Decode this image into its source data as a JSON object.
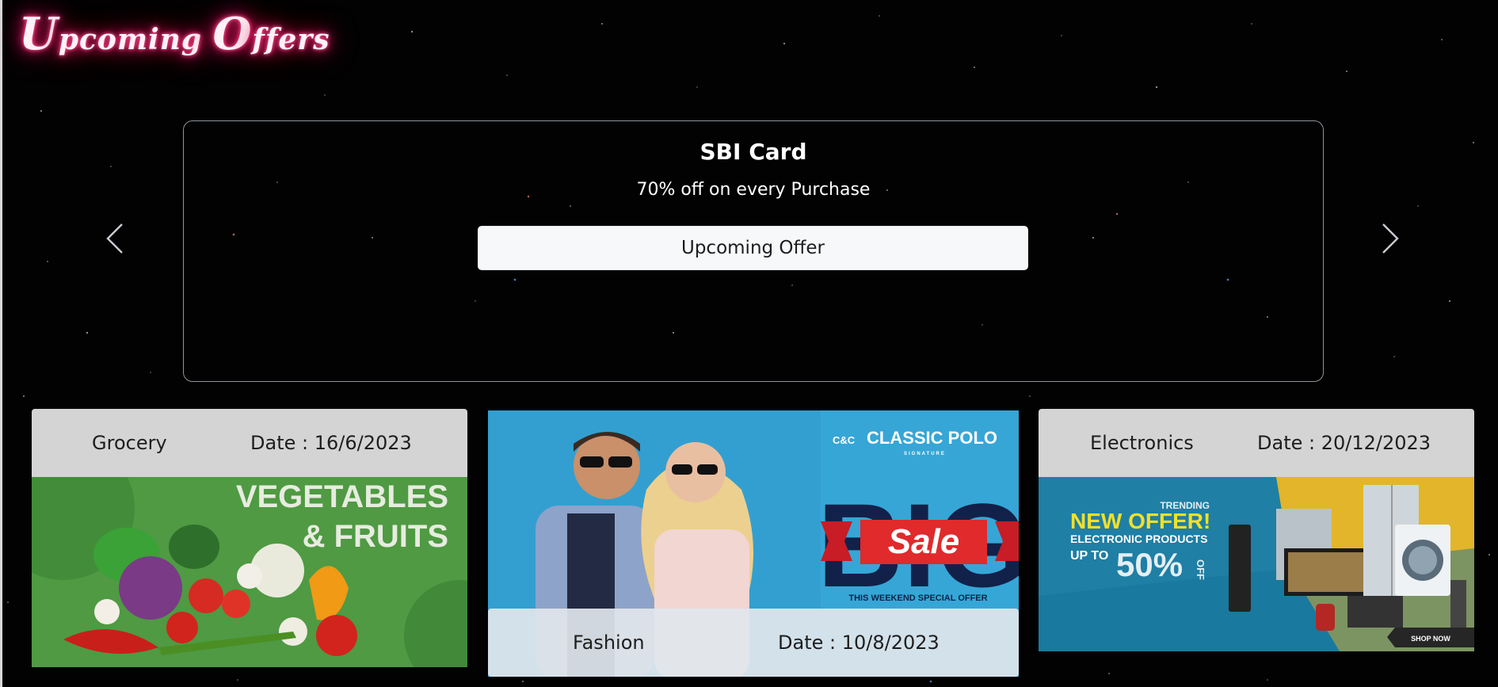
{
  "page": {
    "title_initial_1": "U",
    "title_rest_1": "pcoming",
    "title_initial_2": "O",
    "title_rest_2": "ffers",
    "neon_color": "#ff2f78"
  },
  "carousel": {
    "prev_icon": "chevron-left-icon",
    "next_icon": "chevron-right-icon",
    "active_slide": {
      "title": "SBI Card",
      "description": "70% off on every Purchase",
      "button_label": "Upcoming Offer"
    }
  },
  "cards": [
    {
      "category": "Grocery",
      "date": "Date : 16/6/2023",
      "image": {
        "headline_1": "VEGETABLES",
        "headline_2": "& FRUITS"
      }
    },
    {
      "category": "Fashion",
      "date": "Date : 10/8/2023",
      "image": {
        "brand_prefix": "C&C",
        "brand": "CLASSIC POLO",
        "brand_tag": "SIGNATURE",
        "big": "BIG",
        "sale": "Sale",
        "footer": "THIS WEEKEND SPECIAL OFFER"
      }
    },
    {
      "category": "Electronics",
      "date": "Date : 20/12/2023",
      "image": {
        "trending": "TRENDING",
        "headline": "NEW OFFER!",
        "subline": "ELECTRONIC PRODUCTS",
        "up_to": "UP TO",
        "percent": "50%",
        "off": "OFF",
        "cta": "SHOP NOW"
      }
    }
  ]
}
